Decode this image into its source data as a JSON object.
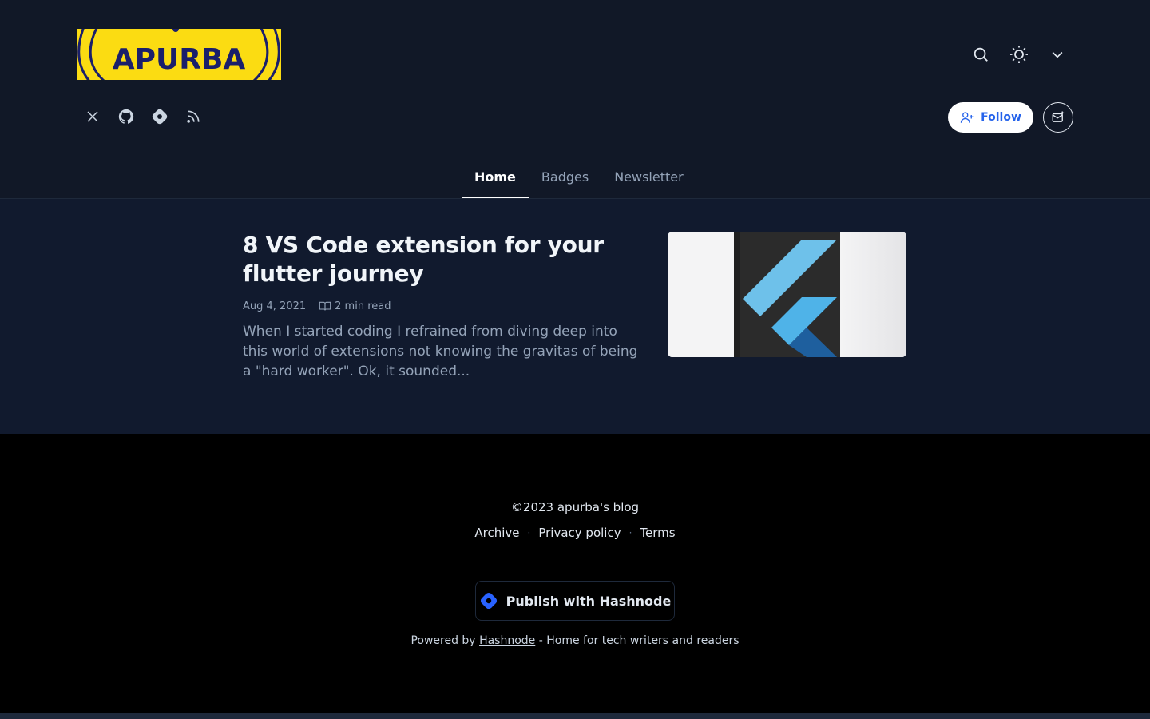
{
  "header": {
    "logo_text": "APURBA",
    "icons": {
      "search": "search-icon",
      "theme": "sun-icon",
      "menu": "chevron-down-icon"
    },
    "social": [
      "x-icon",
      "github-icon",
      "hashnode-icon",
      "rss-icon"
    ],
    "follow_label": "Follow"
  },
  "nav": {
    "tabs": [
      {
        "label": "Home",
        "active": true
      },
      {
        "label": "Badges",
        "active": false
      },
      {
        "label": "Newsletter",
        "active": false
      }
    ]
  },
  "post": {
    "title": "8 VS Code extension for your flutter journey",
    "date": "Aug 4, 2021",
    "read_time": "2 min read",
    "excerpt": "When I started coding I refrained from diving deep into this world of extensions not knowing the gravitas of being a \"hard worker\". Ok, it sounded..."
  },
  "footer": {
    "copyright": "©2023 apurba's blog",
    "links": [
      "Archive",
      "Privacy policy",
      "Terms"
    ],
    "publish_label": "Publish with Hashnode",
    "powered_prefix": "Powered by",
    "powered_link": "Hashnode",
    "powered_suffix": "- Home for tech writers and readers"
  },
  "colors": {
    "background": "#0f172a",
    "logo_yellow": "#fbdc12",
    "accent_blue": "#2563eb",
    "footer_bg": "#000000"
  }
}
